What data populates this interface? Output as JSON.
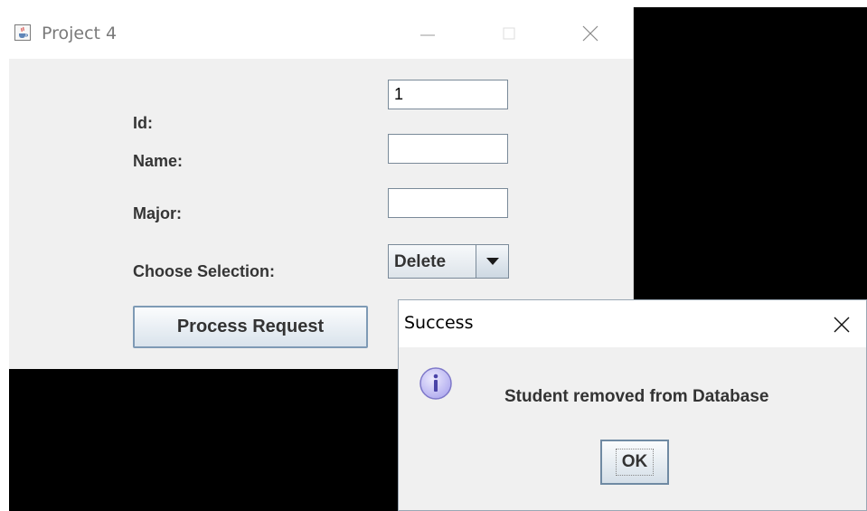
{
  "main_window": {
    "title": "Project 4",
    "labels": {
      "id": "Id:",
      "name": "Name:",
      "major": "Major:",
      "choose": "Choose Selection:"
    },
    "fields": {
      "id_value": "1",
      "name_value": "",
      "major_value": ""
    },
    "selection": {
      "selected": "Delete"
    },
    "process_button": "Process Request"
  },
  "dialog": {
    "title": "Success",
    "message": "Student removed from Database",
    "ok_label": "OK",
    "icon": "info-icon"
  },
  "colors": {
    "window_bg": "#f0f0f0",
    "titlebar_bg": "#ffffff",
    "desktop_bg": "#000000",
    "button_border": "#7e9ab5",
    "info_icon_fill": "#c9c6f5"
  },
  "icons": {
    "app": "java-coffee-icon",
    "minimize": "minimize-icon",
    "maximize": "maximize-icon",
    "close": "close-icon",
    "combo_arrow": "chevron-down-icon"
  }
}
